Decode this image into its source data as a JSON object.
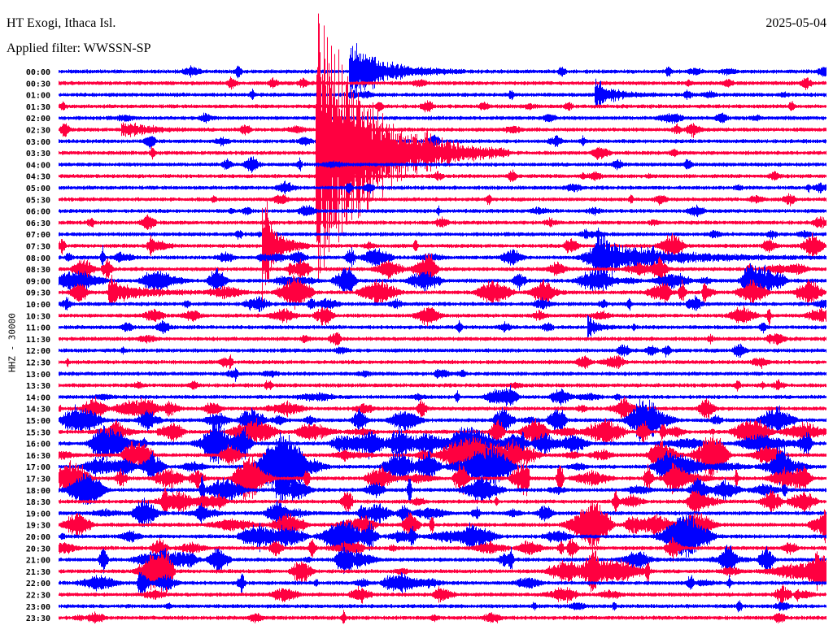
{
  "header": {
    "station": "HT Exogi, Ithaca Isl.",
    "filter": "Applied filter: WWSSN-SP",
    "date": "2025-05-04"
  },
  "chart_data": {
    "type": "helicorder",
    "title": "HT Exogi, Ithaca Isl.",
    "ylabel": "HHZ - 30000",
    "minutes_per_line": 30,
    "colors": [
      "#0000ff",
      "#ff0040"
    ],
    "row_labels": [
      "00:00",
      "00:30",
      "01:00",
      "01:30",
      "02:00",
      "02:30",
      "03:00",
      "03:30",
      "04:00",
      "04:30",
      "05:00",
      "05:30",
      "06:00",
      "06:30",
      "07:00",
      "07:30",
      "08:00",
      "08:30",
      "09:00",
      "09:30",
      "10:00",
      "10:30",
      "11:00",
      "11:30",
      "12:00",
      "12:30",
      "13:00",
      "13:30",
      "14:00",
      "14:30",
      "15:00",
      "15:30",
      "16:00",
      "16:30",
      "17:00",
      "17:30",
      "18:00",
      "18:30",
      "19:00",
      "19:30",
      "20:00",
      "20:30",
      "21:00",
      "21:30",
      "22:00",
      "22:30",
      "23:00",
      "23:30"
    ],
    "activity_level": [
      1,
      1,
      1,
      1,
      1,
      1,
      1,
      1,
      1,
      1,
      1,
      1,
      1,
      1,
      1,
      2,
      3,
      3,
      4,
      4,
      2,
      2,
      1,
      1,
      1,
      1,
      1,
      1,
      2,
      3,
      4,
      4,
      5,
      5,
      5,
      5,
      4,
      3,
      3,
      4,
      4,
      3,
      4,
      4,
      3,
      2,
      1,
      1
    ],
    "events": [
      {
        "row": 0,
        "minute": 11.4,
        "amplitude": 45,
        "duration": 1.5
      },
      {
        "row": 7,
        "minute": 10.1,
        "amplitude": 200,
        "duration": 2.5
      },
      {
        "row": 2,
        "minute": 21.0,
        "amplitude": 22,
        "duration": 0.8
      },
      {
        "row": 15,
        "minute": 8.0,
        "amplitude": 80,
        "duration": 0.6
      },
      {
        "row": 5,
        "minute": 2.5,
        "amplitude": 14,
        "duration": 1.0
      },
      {
        "row": 19,
        "minute": 2.0,
        "amplitude": 16,
        "duration": 1.5
      },
      {
        "row": 22,
        "minute": 20.7,
        "amplitude": 14,
        "duration": 0.4
      },
      {
        "row": 16,
        "minute": 21.0,
        "amplitude": 25,
        "duration": 3.0
      }
    ]
  }
}
